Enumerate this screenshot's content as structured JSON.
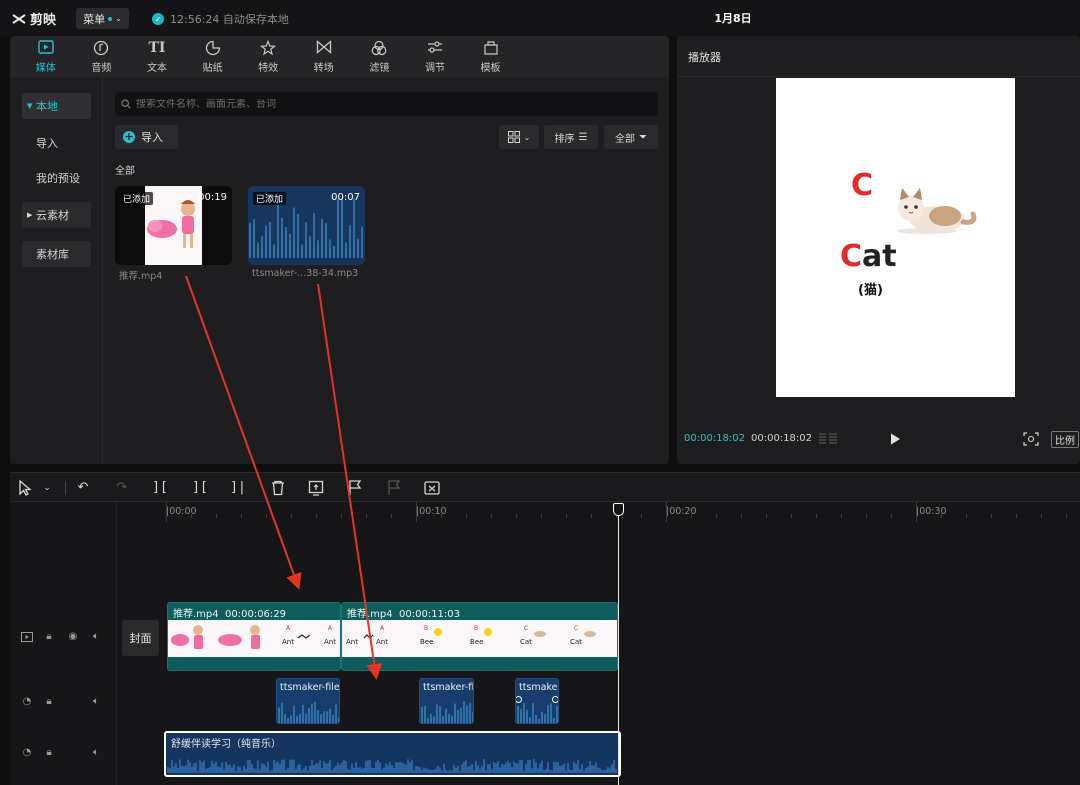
{
  "titlebar": {
    "app_name": "剪映",
    "menu_label": "菜单",
    "save_status": "12:56:24 自动保存本地",
    "project_title": "1月8日"
  },
  "media_toolbar": {
    "tabs": [
      {
        "label": "媒体",
        "icon": "media-icon",
        "active": true
      },
      {
        "label": "音频",
        "icon": "audio-icon"
      },
      {
        "label": "文本",
        "icon": "text-icon"
      },
      {
        "label": "贴纸",
        "icon": "sticker-icon"
      },
      {
        "label": "特效",
        "icon": "effects-icon"
      },
      {
        "label": "转场",
        "icon": "transition-icon"
      },
      {
        "label": "滤镜",
        "icon": "filter-icon"
      },
      {
        "label": "调节",
        "icon": "adjust-icon"
      },
      {
        "label": "模板",
        "icon": "template-icon"
      }
    ]
  },
  "sidebar": {
    "items": [
      {
        "label": "本地",
        "active": true
      },
      {
        "label": "导入"
      },
      {
        "label": "我的预设"
      },
      {
        "label": "云素材"
      },
      {
        "label": "素材库"
      }
    ]
  },
  "search": {
    "placeholder": "搜索文件名称、画面元素、台词",
    "value": ""
  },
  "import_button": "导入",
  "view_controls": {
    "sort_label": "排序",
    "filter_label": "全部"
  },
  "section_label": "全部",
  "media_items": [
    {
      "name": "推荐.mp4",
      "badge": "已添加",
      "duration": "00:19",
      "kind": "video"
    },
    {
      "name": "ttsmaker-...38-34.mp3",
      "badge": "已添加",
      "duration": "00:07",
      "kind": "audio"
    }
  ],
  "player": {
    "title": "播放器",
    "canvas_letter": "C",
    "canvas_word_first": "C",
    "canvas_word_rest": "at",
    "canvas_word_cn": "(猫)",
    "current_time": "00:00:18:02",
    "total_time": "00:00:18:02",
    "ratio_label": "比例"
  },
  "timeline": {
    "ruler_labels": [
      "|00:00",
      "|00:10",
      "|00:20",
      "|00:30"
    ],
    "cover_label": "封面",
    "video_clips": [
      {
        "name": "推荐.mp4",
        "duration": "00:00:06:29"
      },
      {
        "name": "推荐.mp4",
        "duration": "00:00:11:03"
      }
    ],
    "audio_clips": [
      "ttsmaker-file",
      "ttsmaker-fi",
      "ttsmaker"
    ],
    "music_clip": "舒缓伴读学习（纯音乐）"
  }
}
